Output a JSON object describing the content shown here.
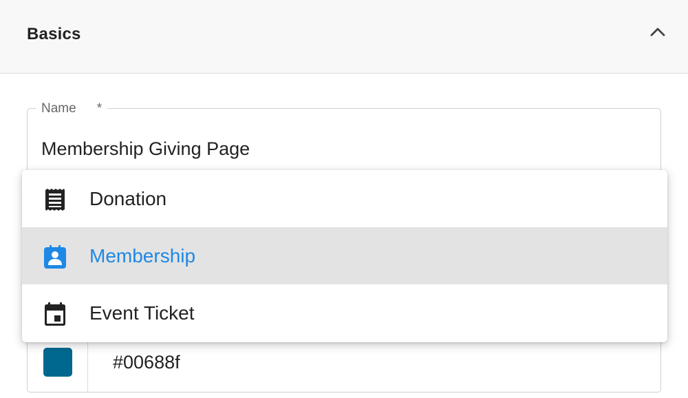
{
  "section": {
    "title": "Basics"
  },
  "name_field": {
    "label": "Name",
    "required_marker": "*",
    "value": "Membership Giving Page"
  },
  "type_menu": {
    "items": [
      {
        "label": "Donation",
        "icon": "receipt-icon",
        "selected": false
      },
      {
        "label": "Membership",
        "icon": "member-badge-icon",
        "selected": true
      },
      {
        "label": "Event Ticket",
        "icon": "calendar-event-icon",
        "selected": false
      }
    ]
  },
  "color_field": {
    "value": "#00688f",
    "swatch_color": "#00688f"
  },
  "colors": {
    "accent": "#1e88e5",
    "selected_background": "#e3e3e3",
    "icon_default": "#222222"
  }
}
